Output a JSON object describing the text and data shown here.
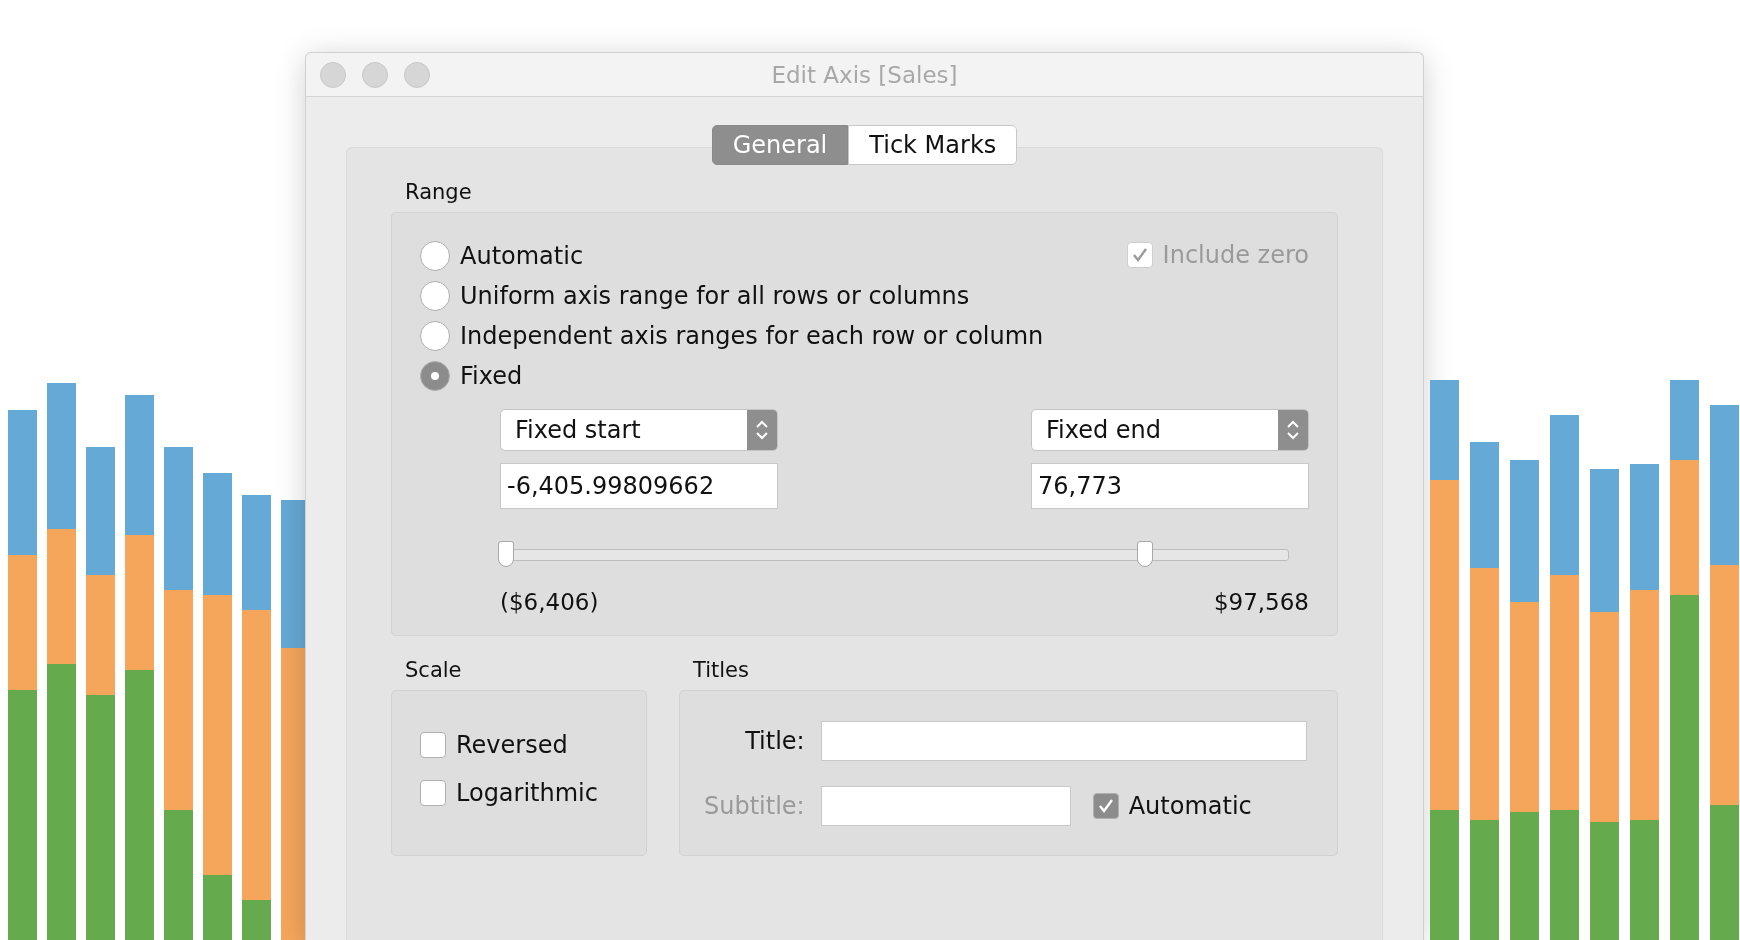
{
  "window": {
    "title": "Edit Axis [Sales]"
  },
  "tabs": [
    {
      "label": "General",
      "selected": true
    },
    {
      "label": "Tick Marks",
      "selected": false
    }
  ],
  "range": {
    "label": "Range",
    "options": [
      {
        "label": "Automatic",
        "selected": false
      },
      {
        "label": "Uniform axis range for all rows or columns",
        "selected": false
      },
      {
        "label": "Independent axis ranges for each row or column",
        "selected": false
      },
      {
        "label": "Fixed",
        "selected": true
      }
    ],
    "include_zero": {
      "label": "Include zero",
      "checked": true,
      "disabled": true
    },
    "start": {
      "dropdown": "Fixed start",
      "value": "-6,405.99809662"
    },
    "end": {
      "dropdown": "Fixed end",
      "value": "76,773"
    },
    "slider": {
      "thumbs": [
        {
          "level": 0
        },
        {
          "level": 0.81
        }
      ],
      "min_label": "($6,406)",
      "max_label": "$97,568"
    }
  },
  "scale": {
    "label": "Scale",
    "options": [
      {
        "label": "Reversed",
        "checked": false
      },
      {
        "label": "Logarithmic",
        "checked": false
      }
    ]
  },
  "titles": {
    "label": "Titles",
    "title": {
      "label": "Title:",
      "disabled": false
    },
    "subtitle": {
      "label": "Subtitle:",
      "disabled": true
    },
    "automatic": {
      "label": "Automatic",
      "checked": true,
      "disabled": false
    }
  }
}
